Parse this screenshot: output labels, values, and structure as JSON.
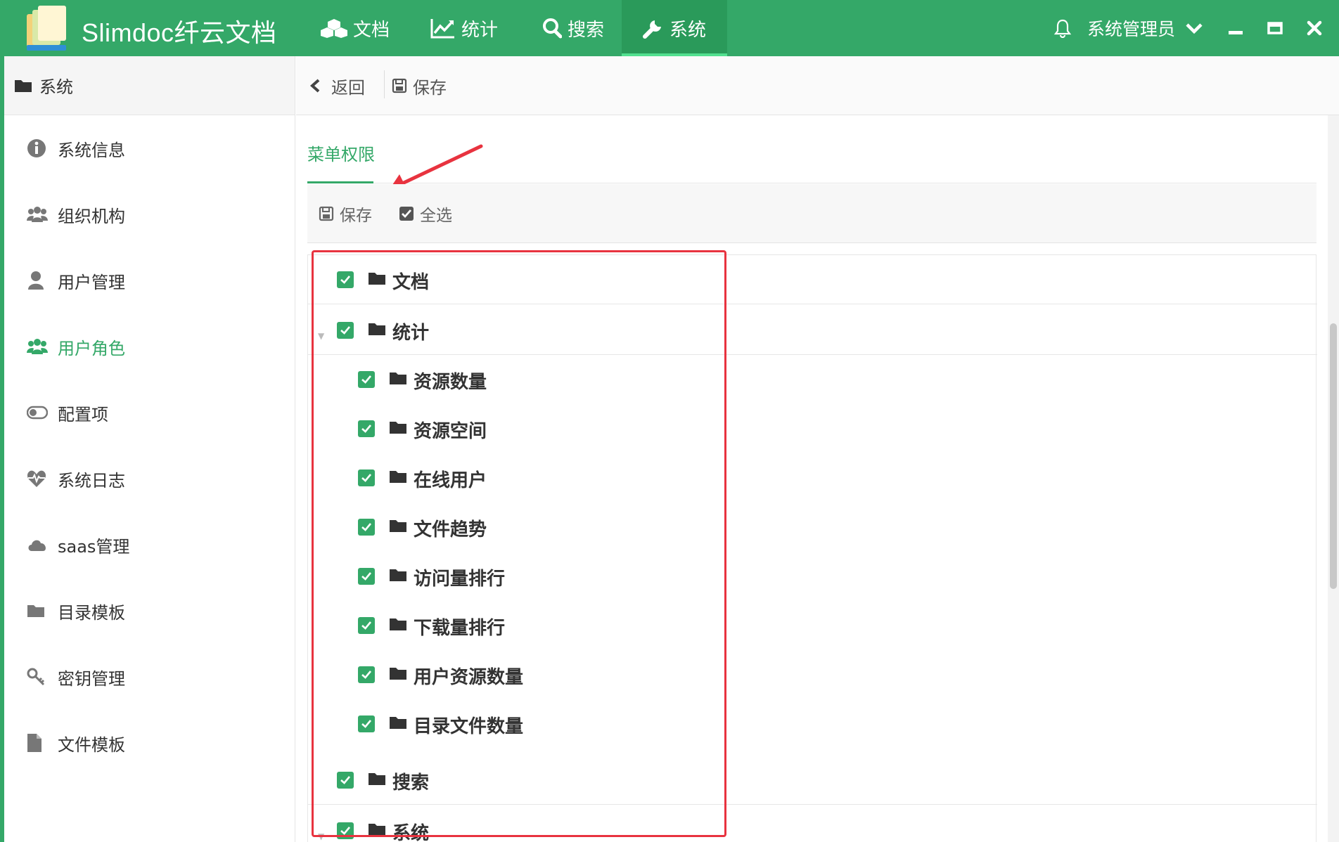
{
  "app": {
    "title": "Slimdoc纤云文档",
    "user": "系统管理员",
    "colors": {
      "primary": "#34a868",
      "active_tab": "#2a9a5a",
      "annotation": "#e8333f"
    }
  },
  "nav": {
    "tabs": [
      {
        "label": "文档",
        "icon": "cubes-icon",
        "active": false
      },
      {
        "label": "统计",
        "icon": "line-chart-icon",
        "active": false
      },
      {
        "label": "搜索",
        "icon": "search-icon",
        "active": false
      },
      {
        "label": "系统",
        "icon": "wrench-icon",
        "active": true
      }
    ]
  },
  "sidebar": {
    "header": "系统",
    "items": [
      {
        "label": "系统信息",
        "icon": "info-circle-icon",
        "active": false
      },
      {
        "label": "组织机构",
        "icon": "group-icon",
        "active": false
      },
      {
        "label": "用户管理",
        "icon": "user-icon",
        "active": false
      },
      {
        "label": "用户角色",
        "icon": "users-icon",
        "active": true
      },
      {
        "label": "配置项",
        "icon": "toggle-icon",
        "active": false
      },
      {
        "label": "系统日志",
        "icon": "heartbeat-icon",
        "active": false
      },
      {
        "label": "saas管理",
        "icon": "cloud-icon",
        "active": false
      },
      {
        "label": "目录模板",
        "icon": "folder-icon",
        "active": false
      },
      {
        "label": "密钥管理",
        "icon": "key-icon",
        "active": false
      },
      {
        "label": "文件模板",
        "icon": "file-icon",
        "active": false
      }
    ]
  },
  "toolbar": {
    "back_label": "返回",
    "save_label": "保存"
  },
  "permissions": {
    "tab_label": "菜单权限",
    "save_label": "保存",
    "select_all_label": "全选",
    "tree": [
      {
        "label": "文档",
        "checked": true,
        "level": 0
      },
      {
        "label": "统计",
        "checked": true,
        "level": 0,
        "expanded": true
      },
      {
        "label": "资源数量",
        "checked": true,
        "level": 1
      },
      {
        "label": "资源空间",
        "checked": true,
        "level": 1
      },
      {
        "label": "在线用户",
        "checked": true,
        "level": 1
      },
      {
        "label": "文件趋势",
        "checked": true,
        "level": 1
      },
      {
        "label": "访问量排行",
        "checked": true,
        "level": 1
      },
      {
        "label": "下载量排行",
        "checked": true,
        "level": 1
      },
      {
        "label": "用户资源数量",
        "checked": true,
        "level": 1
      },
      {
        "label": "目录文件数量",
        "checked": true,
        "level": 1
      },
      {
        "label": "搜索",
        "checked": true,
        "level": 0
      },
      {
        "label": "系统",
        "checked": true,
        "level": 0,
        "expanded": true
      }
    ]
  }
}
